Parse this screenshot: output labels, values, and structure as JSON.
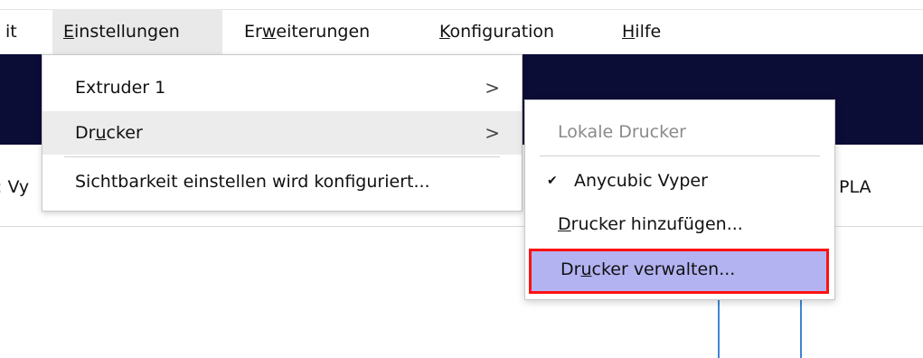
{
  "menubar": {
    "items": [
      {
        "name": "ansicht",
        "label": "it"
      },
      {
        "name": "einstellungen",
        "label_ul": "E",
        "label_rest": "instellungen",
        "active": true
      },
      {
        "name": "erweiterungen",
        "label_pre": "Er",
        "label_ul": "w",
        "label_rest": "eiterungen"
      },
      {
        "name": "konfiguration",
        "label_ul": "K",
        "label_rest": "onfiguration"
      },
      {
        "name": "hilfe",
        "label_ul": "H",
        "label_rest": "ilfe"
      }
    ]
  },
  "toolbar": {
    "printer_text": ": Vy",
    "material_text": "PLA"
  },
  "settings_menu": {
    "items": [
      {
        "label": "Extruder 1",
        "submenu_indicator": ">"
      },
      {
        "label_pre": "Dr",
        "label_ul": "u",
        "label_rest": "cker",
        "submenu_indicator": ">"
      },
      {
        "label": "Sichtbarkeit einstellen wird konfiguriert..."
      }
    ]
  },
  "printer_submenu": {
    "section_header": "Lokale Drucker",
    "printers": [
      {
        "label": "Anycubic Vyper",
        "checked": true,
        "check_mark": "✔"
      }
    ],
    "add_printer": {
      "label_ul": "D",
      "label_rest": "rucker hinzufügen..."
    },
    "manage_printers": {
      "label_pre": "Dr",
      "label_ul": "u",
      "label_rest": "cker verwalten..."
    }
  },
  "colors": {
    "dark_band": "#0b0d37",
    "highlight_fill": "#b3b3f2",
    "highlight_border": "#ff1111",
    "viewport_line": "#3f86d6"
  }
}
